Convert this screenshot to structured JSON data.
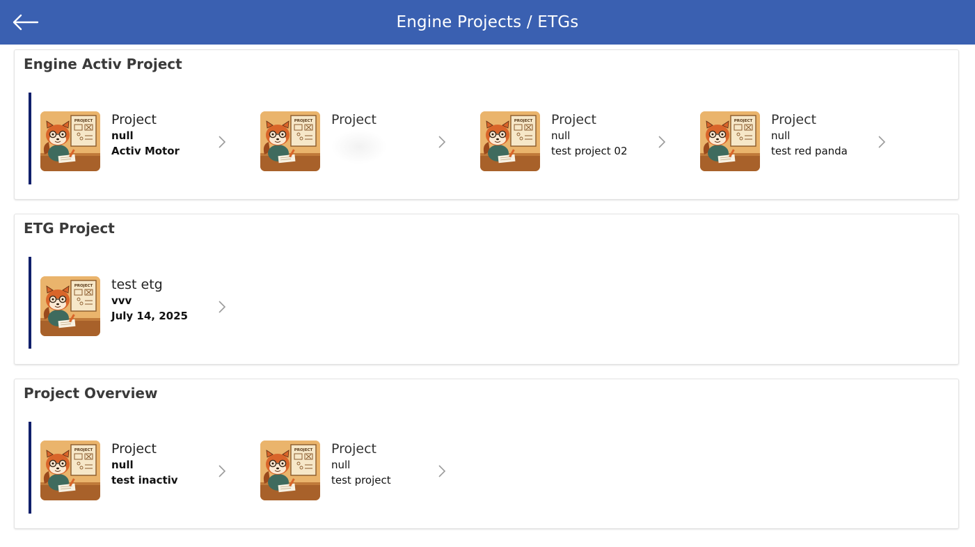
{
  "header": {
    "title": "Engine Projects / ETGs",
    "back_icon": "arrow-left-icon"
  },
  "sections": [
    {
      "title": "Engine Activ Project",
      "items": [
        {
          "title": "Project",
          "line1": "null",
          "line2": "Activ Motor"
        },
        {
          "title": "Project",
          "line1": "",
          "line2": ""
        },
        {
          "title": "Project",
          "line1": "null",
          "line2": "test project 02"
        },
        {
          "title": "Project",
          "line1": "null",
          "line2": "test red panda"
        }
      ]
    },
    {
      "title": "ETG Project",
      "items": [
        {
          "title": "test etg",
          "line1": "vvv",
          "line2": "July 14, 2025"
        }
      ]
    },
    {
      "title": "Project Overview",
      "items": [
        {
          "title": "Project",
          "line1": "null",
          "line2": "test inactiv"
        },
        {
          "title": "Project",
          "line1": "null",
          "line2": "test project"
        }
      ]
    }
  ],
  "thumbnail": {
    "label": "PROJECT"
  },
  "colors": {
    "header": "#3a60b1",
    "accent_bar": "#101f6b"
  }
}
